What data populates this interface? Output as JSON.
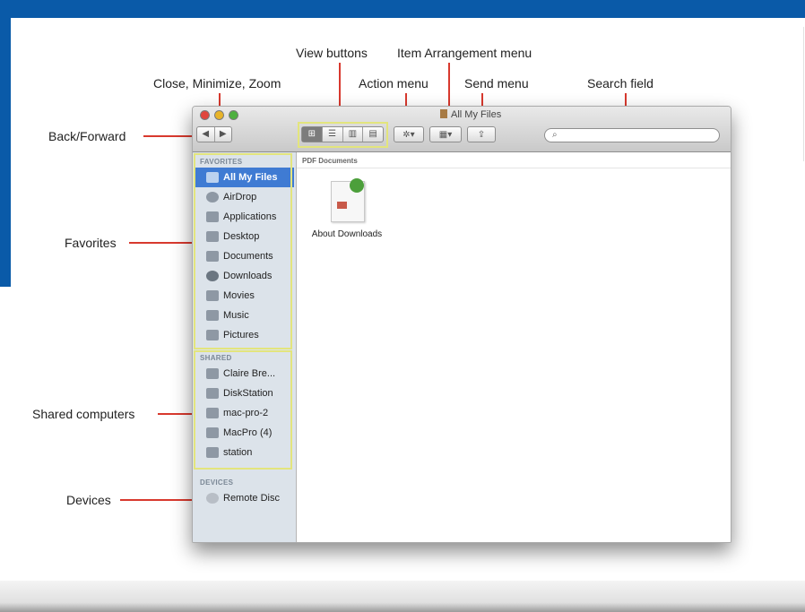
{
  "annotations": {
    "close_minimize_zoom": "Close, Minimize, Zoom",
    "view_buttons": "View buttons",
    "item_arrangement_menu": "Item Arrangement menu",
    "action_menu": "Action menu",
    "send_menu": "Send menu",
    "search_field": "Search field",
    "back_forward": "Back/Forward",
    "favorites": "Favorites",
    "shared_computers": "Shared computers",
    "devices": "Devices"
  },
  "window": {
    "title": "All My Files"
  },
  "toolbar": {
    "back_glyph": "◀",
    "forward_glyph": "▶",
    "view_glyphs": [
      "⊞",
      "☰",
      "▥",
      "▤"
    ],
    "action_glyph": "✲▾",
    "arrange_glyph": "▦▾",
    "send_glyph": "⇪",
    "search_glyph": "⌕",
    "search_placeholder": ""
  },
  "sidebar": {
    "favorites_heading": "FAVORITES",
    "favorites": [
      {
        "label": "All My Files",
        "icon": "all-my-files-icon",
        "selected": true
      },
      {
        "label": "AirDrop",
        "icon": "airdrop-icon"
      },
      {
        "label": "Applications",
        "icon": "applications-icon"
      },
      {
        "label": "Desktop",
        "icon": "desktop-icon"
      },
      {
        "label": "Documents",
        "icon": "documents-icon"
      },
      {
        "label": "Downloads",
        "icon": "downloads-icon"
      },
      {
        "label": "Movies",
        "icon": "movies-icon"
      },
      {
        "label": "Music",
        "icon": "music-icon"
      },
      {
        "label": "Pictures",
        "icon": "pictures-icon"
      }
    ],
    "shared_heading": "SHARED",
    "shared": [
      {
        "label": "Claire Bre...",
        "icon": "computer-icon"
      },
      {
        "label": "DiskStation",
        "icon": "server-icon"
      },
      {
        "label": "mac-pro-2",
        "icon": "computer-icon"
      },
      {
        "label": "MacPro (4)",
        "icon": "mac-pro-icon"
      },
      {
        "label": "station",
        "icon": "computer-icon"
      }
    ],
    "devices_heading": "DEVICES",
    "devices": [
      {
        "label": "Remote Disc",
        "icon": "remote-disc-icon"
      }
    ]
  },
  "content": {
    "section_heading": "PDF Documents",
    "files": [
      {
        "label": "About Downloads",
        "icon": "pdf-file-icon"
      }
    ]
  },
  "colors": {
    "frame_blue": "#0a5aa8",
    "callout_line": "#d8392e",
    "highlight_box": "#e3e57d",
    "selection": "#3f7bd3",
    "sidebar_bg": "#dce3ea",
    "close": "#e0463d",
    "minimize": "#e8b42a",
    "zoom": "#4eb040"
  }
}
